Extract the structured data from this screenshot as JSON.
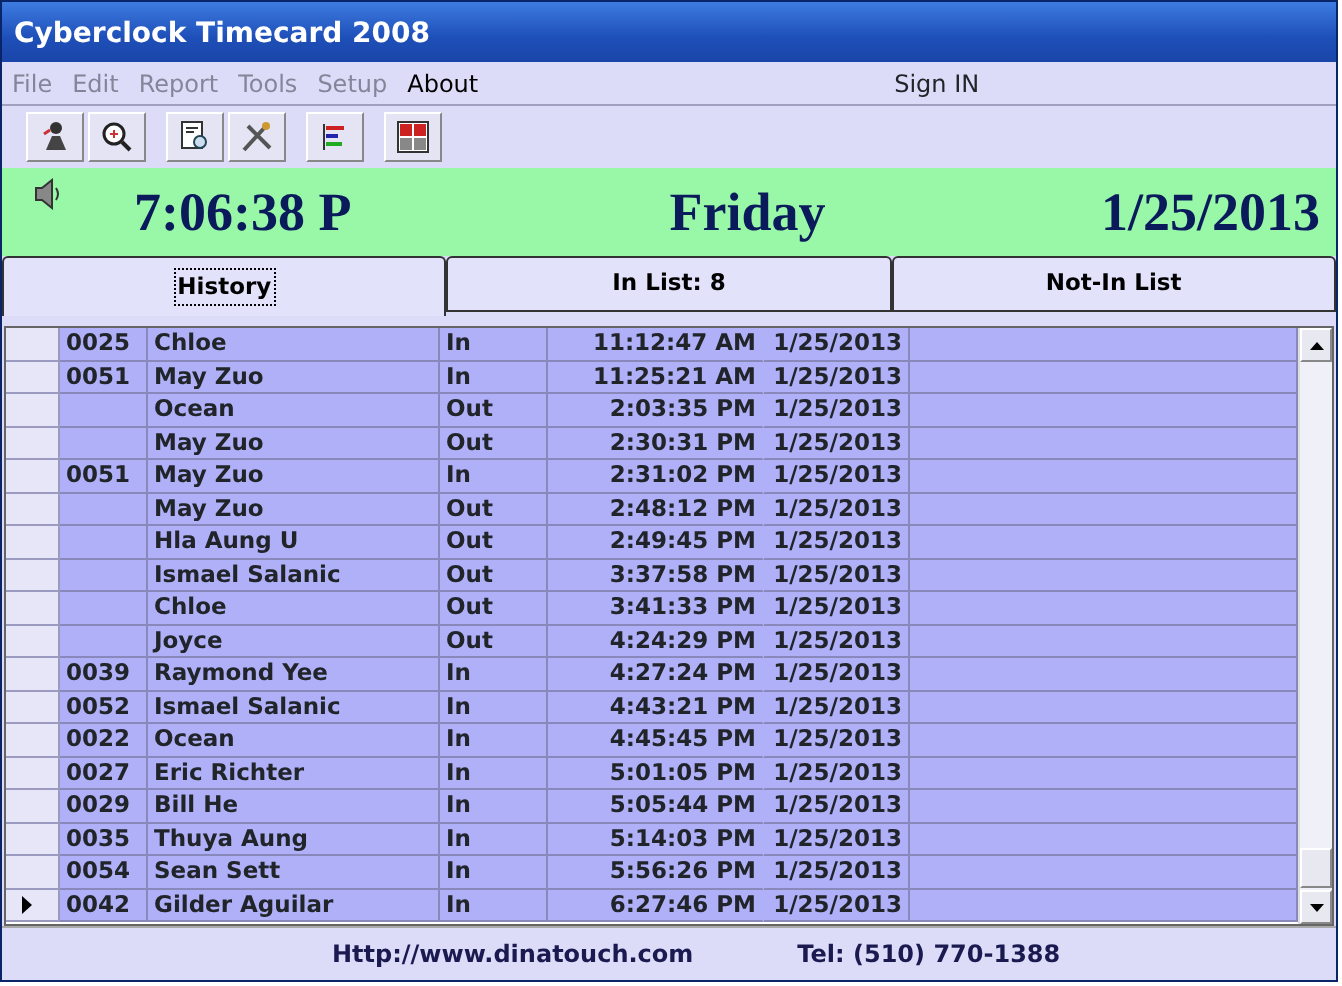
{
  "window": {
    "title": "Cyberclock Timecard 2008"
  },
  "menu": [
    {
      "label": "File",
      "disabled": true
    },
    {
      "label": "Edit",
      "disabled": true
    },
    {
      "label": "Report",
      "disabled": true
    },
    {
      "label": "Tools",
      "disabled": true
    },
    {
      "label": "Setup",
      "disabled": true
    },
    {
      "label": "About",
      "disabled": false
    }
  ],
  "mode": "Sign IN",
  "clock": {
    "time": "7:06:38 P",
    "day": "Friday",
    "date": "1/25/2013"
  },
  "tabs": [
    {
      "label": "History",
      "selected": true
    },
    {
      "label": "In List: 8",
      "selected": false
    },
    {
      "label": "Not-In List",
      "selected": false
    }
  ],
  "rows": [
    {
      "id": "0025",
      "name": "Chloe",
      "type": "In",
      "time": "11:12:47 AM",
      "date": "1/25/2013",
      "current": false
    },
    {
      "id": "0051",
      "name": "May Zuo",
      "type": "In",
      "time": "11:25:21 AM",
      "date": "1/25/2013",
      "current": false
    },
    {
      "name": "Ocean",
      "type": "Out",
      "time": "2:03:35 PM",
      "date": "1/25/2013",
      "current": false
    },
    {
      "name": "May Zuo",
      "type": "Out",
      "time": "2:30:31 PM",
      "date": "1/25/2013",
      "current": false
    },
    {
      "id": "0051",
      "name": "May Zuo",
      "type": "In",
      "time": "2:31:02 PM",
      "date": "1/25/2013",
      "current": false
    },
    {
      "name": "May Zuo",
      "type": "Out",
      "time": "2:48:12 PM",
      "date": "1/25/2013",
      "current": false
    },
    {
      "name": "Hla Aung U",
      "type": "Out",
      "time": "2:49:45 PM",
      "date": "1/25/2013",
      "current": false
    },
    {
      "name": "Ismael Salanic",
      "type": "Out",
      "time": "3:37:58 PM",
      "date": "1/25/2013",
      "current": false
    },
    {
      "name": "Chloe",
      "type": "Out",
      "time": "3:41:33 PM",
      "date": "1/25/2013",
      "current": false
    },
    {
      "name": "Joyce",
      "type": "Out",
      "time": "4:24:29 PM",
      "date": "1/25/2013",
      "current": false
    },
    {
      "id": "0039",
      "name": "Raymond Yee",
      "type": "In",
      "time": "4:27:24 PM",
      "date": "1/25/2013",
      "current": false
    },
    {
      "id": "0052",
      "name": "Ismael Salanic",
      "type": "In",
      "time": "4:43:21 PM",
      "date": "1/25/2013",
      "current": false
    },
    {
      "id": "0022",
      "name": "Ocean",
      "type": "In",
      "time": "4:45:45 PM",
      "date": "1/25/2013",
      "current": false
    },
    {
      "id": "0027",
      "name": "Eric Richter",
      "type": "In",
      "time": "5:01:05 PM",
      "date": "1/25/2013",
      "current": false
    },
    {
      "id": "0029",
      "name": "Bill He",
      "type": "In",
      "time": "5:05:44 PM",
      "date": "1/25/2013",
      "current": false
    },
    {
      "id": "0035",
      "name": "Thuya Aung",
      "type": "In",
      "time": "5:14:03 PM",
      "date": "1/25/2013",
      "current": false
    },
    {
      "id": "0054",
      "name": "Sean Sett",
      "type": "In",
      "time": "5:56:26 PM",
      "date": "1/25/2013",
      "current": false
    },
    {
      "id": "0042",
      "name": "Gilder Aguilar",
      "type": "In",
      "time": "6:27:46 PM",
      "date": "1/25/2013",
      "current": true
    }
  ],
  "footer": {
    "website": "Http://www.dinatouch.com",
    "phone": "Tel: (510) 770-1388"
  }
}
